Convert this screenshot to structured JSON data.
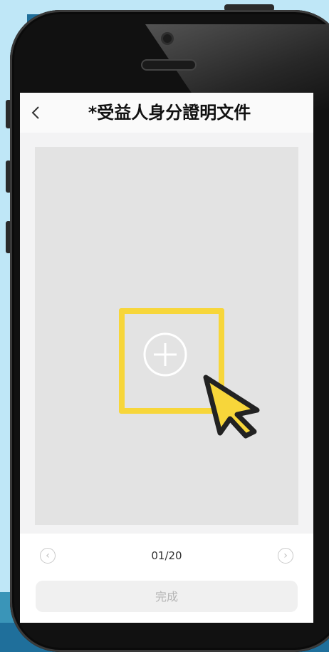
{
  "screen": {
    "title": "*受益人身分證明文件",
    "back_icon": "chevron-left-icon",
    "upload": {
      "icon": "plus-circle-icon",
      "cursor_icon": "cursor-pointer-icon",
      "highlight_color": "#f7d63a"
    },
    "pager": {
      "current": "01/20",
      "prev_icon": "chevron-left-circle-icon",
      "next_icon": "chevron-right-circle-icon"
    },
    "done_label": "完成"
  }
}
